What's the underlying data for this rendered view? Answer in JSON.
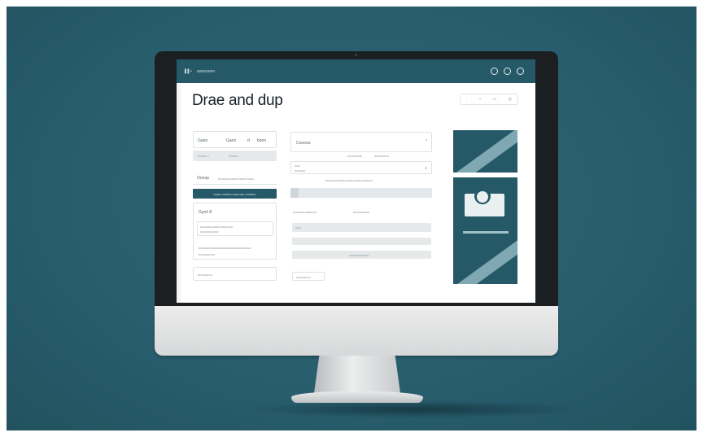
{
  "window": {
    "app_label": "▌▌•",
    "nav_label": "uooooooo"
  },
  "page": {
    "title": "Drae and dup",
    "top_controls": [
      ":",
      "○",
      "▭",
      "◎"
    ]
  },
  "left_column": {
    "row1": [
      "Gaon",
      "Gaon",
      "d",
      "boon"
    ],
    "row1_sub": [
      "oooor 2",
      "ooooo"
    ],
    "row2_label": "Oooop",
    "row2_sub": "uuuuuuuuuuuuuuuuuuuu",
    "button_label": "uuuu uuuuuu uuuuuu uuuuuu",
    "section_title": "Gyrel 8",
    "textarea_lines": [
      "uuuuuuuuuuuuuuuuuu",
      "uuuuuuuuuu ·"
    ],
    "note_line": "uuuuuuuuuuuuuuuuuuuuuuuuuuuuu",
    "checkbox_label": "uuuuuuuuu",
    "bottom_field": "uuuuuuuu"
  },
  "middle_column": {
    "select_label": "Coooou",
    "select_hint": "oooooooo",
    "field_label": "uuu",
    "field_value": "uuuuuu",
    "field_help": "uuuuuuuuuuuuuuuuuuuuuuuuuu",
    "table_headers": [
      "uuuuuuuuuuuuu",
      "uuuuuuuuu"
    ],
    "table_row_text": "uuu",
    "table_footer": "uuuuuuuuuuu",
    "small_button": "uuuuuuuu"
  },
  "colors": {
    "brand": "#265967",
    "accent_light": "#7fa8b3"
  }
}
